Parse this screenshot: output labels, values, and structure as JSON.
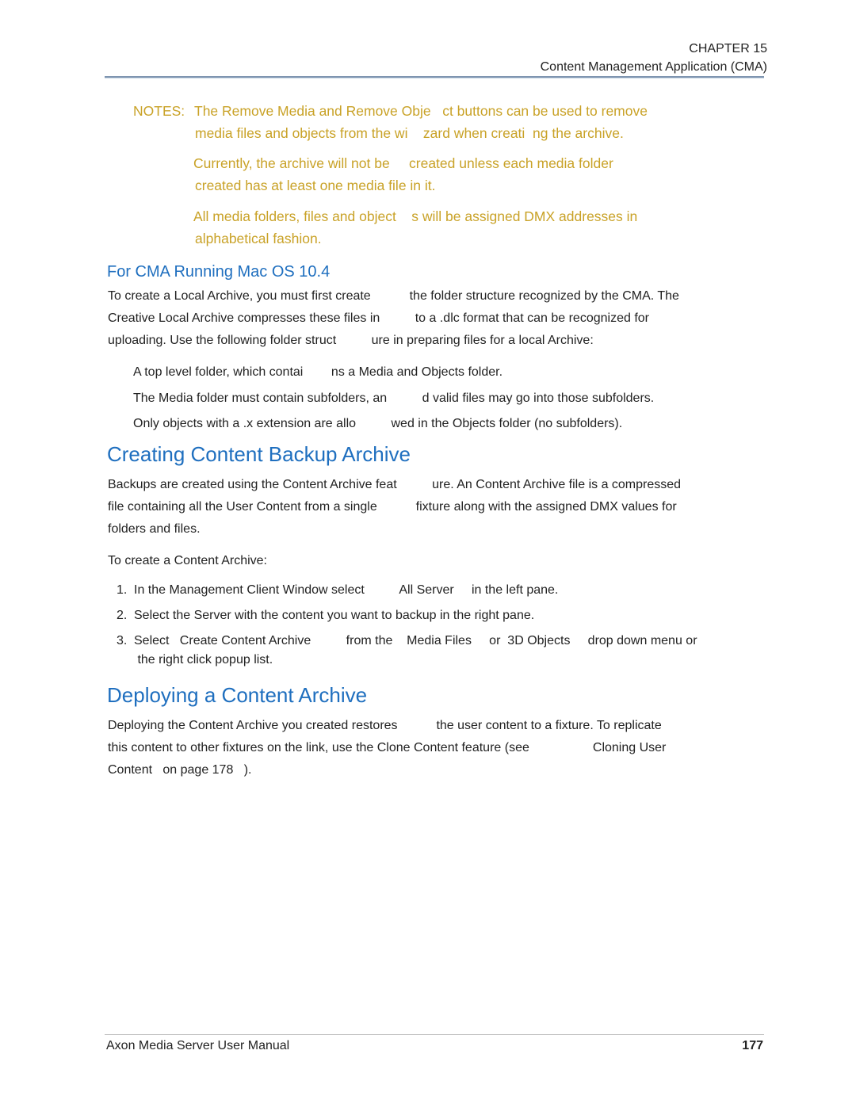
{
  "header": {
    "chapter": "CHAPTER 15",
    "subtitle": "Content Management Application (CMA)"
  },
  "notes": {
    "label": "NOTES:",
    "items": [
      {
        "lines": [
          "The Remove Media and Remove Obje   ct buttons can be used to remove",
          "media files and objects from the wi    zard when creati  ng the archive."
        ]
      },
      {
        "lines": [
          "Currently, the archive will not be     created unless each media folder",
          "created has at least one media file in it."
        ]
      },
      {
        "lines": [
          "All media folders, files and object    s will be assigned DMX addresses in",
          "alphabetical fashion."
        ]
      }
    ]
  },
  "section_mac": {
    "heading": "For CMA Running Mac OS 10.4",
    "paragraph_lines": [
      "To create a Local Archive, you must first create           the folder structure recognized by the CMA. The",
      "Creative Local Archive compresses these files in          to a .dlc format that can be recognized for",
      "uploading. Use the following folder struct          ure in preparing files for a local Archive:"
    ],
    "bullets": [
      "A top level folder, which contai        ns a Media and Objects folder.",
      "The Media folder must contain subfolders, an          d valid files may go into those subfolders.",
      "Only objects with a .x extension are allo          wed in the Objects folder (no subfolders)."
    ]
  },
  "section_backup": {
    "heading": "Creating Content Backup Archive",
    "paragraph_lines": [
      "Backups are created using the Content Archive feat          ure. An Content Archive file is a compressed",
      "file containing all the User Content from a single           fixture along with the assigned DMX values for",
      "folders and files."
    ],
    "intro": "To create a Content Archive:",
    "steps": [
      {
        "num": "1.",
        "lines": [
          "In the Management Client Window select          All Server     in the left pane."
        ]
      },
      {
        "num": "2.",
        "lines": [
          "Select the Server with the content you want to backup in the right pane."
        ]
      },
      {
        "num": "3.",
        "lines": [
          "Select   Create Content Archive          from the    Media Files     or  3D Objects     drop down menu or",
          " the right click popup list."
        ]
      }
    ]
  },
  "section_deploy": {
    "heading": "Deploying a Content Archive",
    "paragraph_lines": [
      "Deploying the Content Archive you created restores           the user content to a fixture. To replicate",
      "this content to other fixtures on the link, use the Clone Content feature (see                  Cloning User",
      "Content   on page 178   )."
    ]
  },
  "footer": {
    "title": "Axon Media Server User Manual",
    "page_number": "177"
  }
}
